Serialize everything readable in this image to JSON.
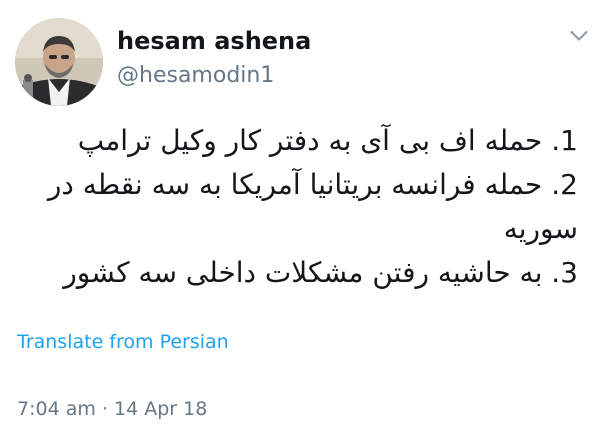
{
  "tweet": {
    "author": {
      "display_name": "hesam ashena",
      "handle": "@hesamodin1",
      "avatar_icon": "profile-photo"
    },
    "menu_icon": "chevron-down-icon",
    "lines": [
      "1. حمله اف بی آی به دفتر کار وکیل ترامپ",
      "2. حمله فرانسه بریتانیا آمریکا  به سه نقطه در",
      "سوریه",
      "3. به حاشیه رفتن مشکلات داخلی سه کشور"
    ],
    "translate_label": "Translate from Persian",
    "timestamp": "7:04 am · 14 Apr 18"
  },
  "colors": {
    "text": "#14171a",
    "secondary": "#657786",
    "link": "#1da1f2",
    "background": "#ffffff"
  }
}
